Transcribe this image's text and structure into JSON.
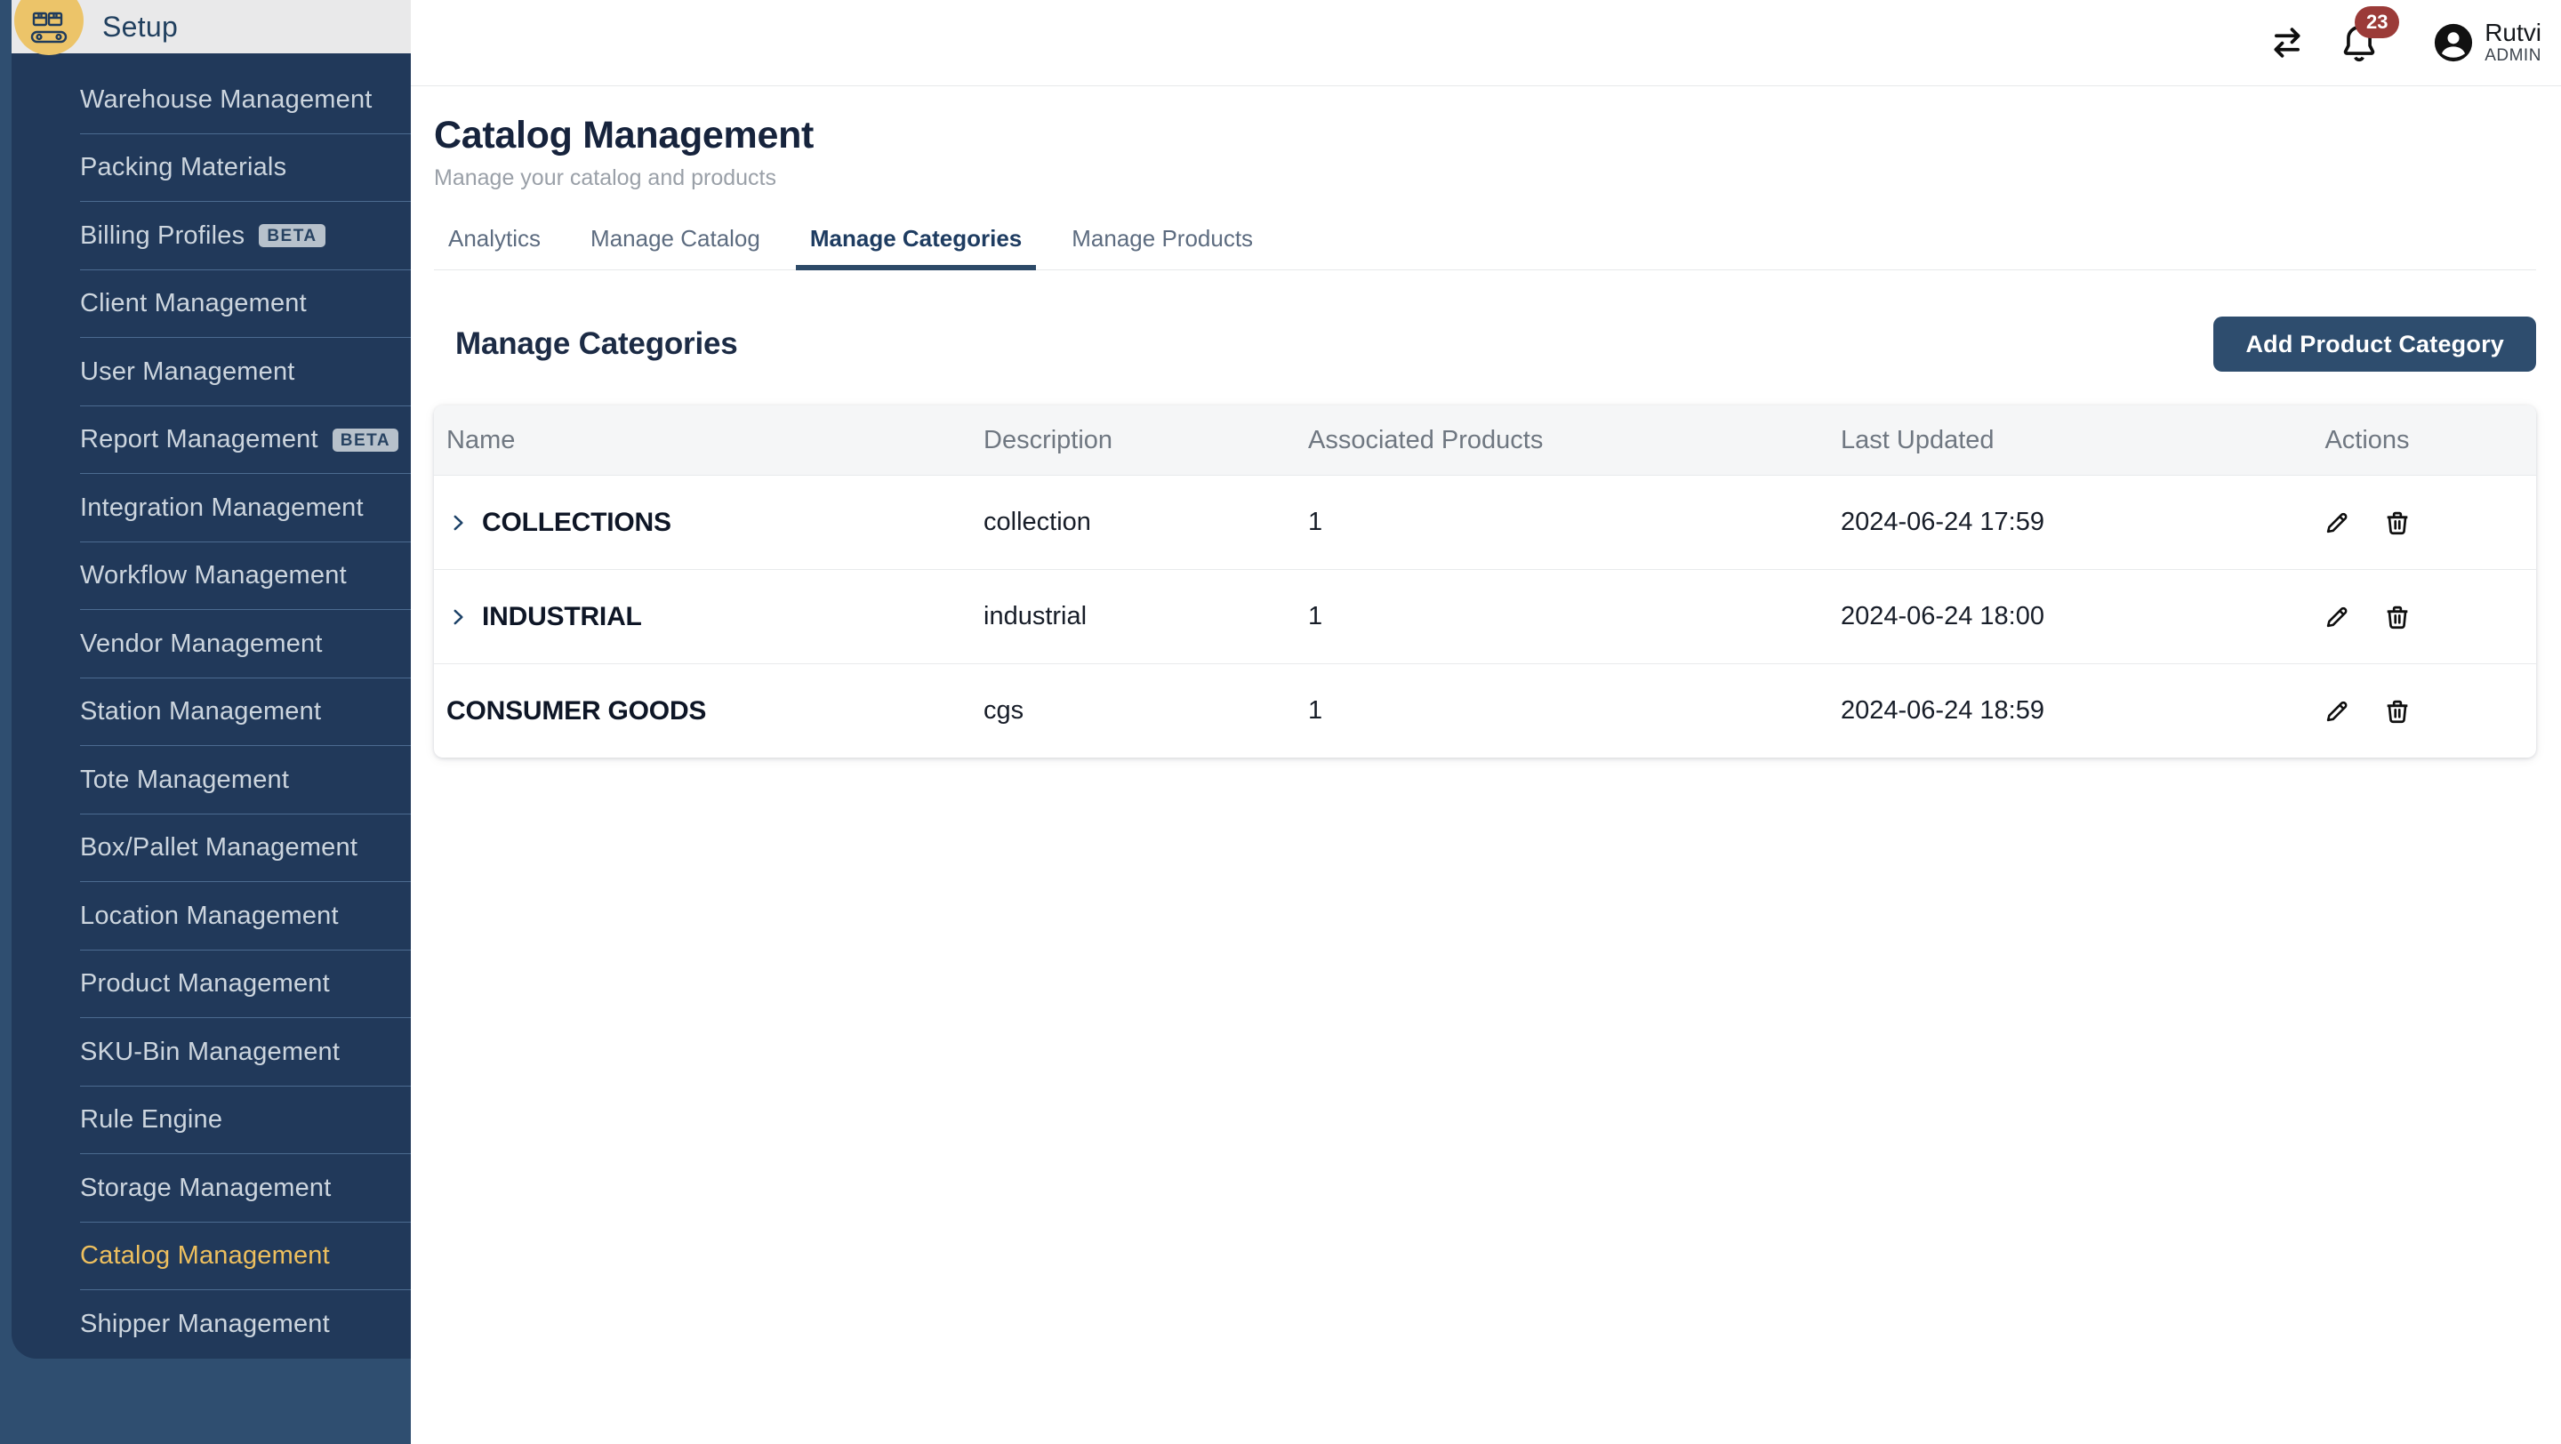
{
  "sidebar": {
    "header_label": "Setup",
    "app_icon": "conveyor-boxes-icon",
    "beta_badge_label": "BETA",
    "items": [
      {
        "label": "Warehouse Management",
        "beta": false,
        "active": false
      },
      {
        "label": "Packing Materials",
        "beta": false,
        "active": false
      },
      {
        "label": "Billing Profiles",
        "beta": true,
        "active": false
      },
      {
        "label": "Client Management",
        "beta": false,
        "active": false
      },
      {
        "label": "User Management",
        "beta": false,
        "active": false
      },
      {
        "label": "Report Management",
        "beta": true,
        "active": false
      },
      {
        "label": "Integration Management",
        "beta": false,
        "active": false
      },
      {
        "label": "Workflow Management",
        "beta": false,
        "active": false
      },
      {
        "label": "Vendor Management",
        "beta": false,
        "active": false
      },
      {
        "label": "Station Management",
        "beta": false,
        "active": false
      },
      {
        "label": "Tote Management",
        "beta": false,
        "active": false
      },
      {
        "label": "Box/Pallet Management",
        "beta": false,
        "active": false
      },
      {
        "label": "Location Management",
        "beta": false,
        "active": false
      },
      {
        "label": "Product Management",
        "beta": false,
        "active": false
      },
      {
        "label": "SKU-Bin Management",
        "beta": false,
        "active": false
      },
      {
        "label": "Rule Engine",
        "beta": false,
        "active": false
      },
      {
        "label": "Storage Management",
        "beta": false,
        "active": false
      },
      {
        "label": "Catalog Management",
        "beta": false,
        "active": true
      },
      {
        "label": "Shipper Management",
        "beta": false,
        "active": false
      }
    ]
  },
  "topbar": {
    "icons": [
      "swap-arrows-icon",
      "notification-bell-icon",
      "user-avatar-icon"
    ],
    "notification_count": "23",
    "user": {
      "name": "Rutvi",
      "role": "ADMIN"
    }
  },
  "page": {
    "title": "Catalog Management",
    "subtitle": "Manage your catalog and products",
    "tabs": [
      {
        "label": "Analytics",
        "active": false
      },
      {
        "label": "Manage Catalog",
        "active": false
      },
      {
        "label": "Manage Categories",
        "active": true
      },
      {
        "label": "Manage Products",
        "active": false
      }
    ]
  },
  "section": {
    "heading": "Manage Categories",
    "add_button_label": "Add Product Category"
  },
  "table": {
    "columns": [
      "Name",
      "Description",
      "Associated Products",
      "Last Updated",
      "Actions"
    ],
    "row_action_icons": [
      "edit-pencil-icon",
      "delete-trash-icon"
    ],
    "rows": [
      {
        "name": "COLLECTIONS",
        "expandable": true,
        "description": "collection",
        "associated_products": "1",
        "last_updated": "2024-06-24 17:59"
      },
      {
        "name": "INDUSTRIAL",
        "expandable": true,
        "description": "industrial",
        "associated_products": "1",
        "last_updated": "2024-06-24 18:00"
      },
      {
        "name": "CONSUMER GOODS",
        "expandable": false,
        "description": "cgs",
        "associated_products": "1",
        "last_updated": "2024-06-24 18:59"
      }
    ]
  },
  "colors": {
    "sidebar_outer": "#2f4e70",
    "sidebar_panel": "#21395a",
    "sidebar_active": "#edbf5e",
    "app_badge": "#ecc469",
    "header_gray": "#e9e9ea",
    "accent_navy": "#2e4d6e",
    "notification_red": "#9b3b38",
    "title_navy": "#16233c"
  }
}
